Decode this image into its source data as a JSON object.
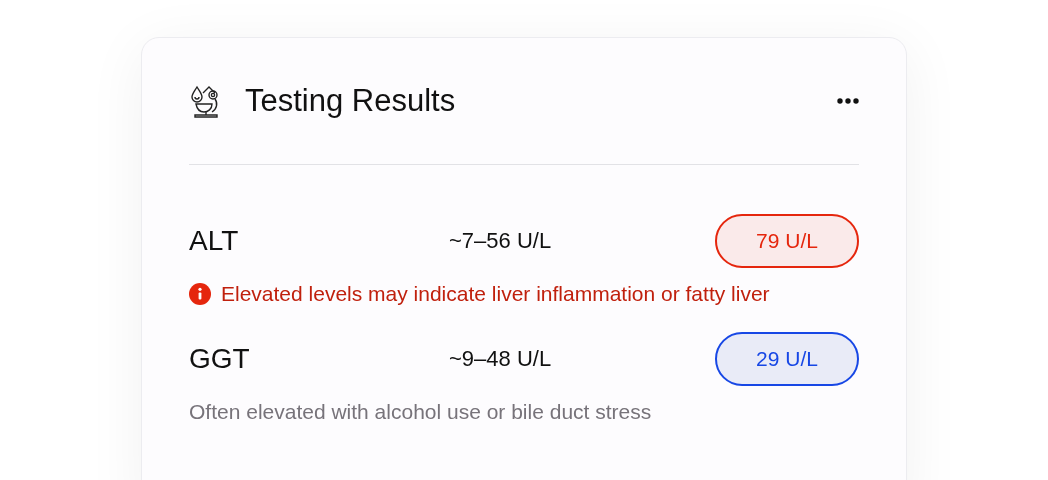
{
  "card": {
    "title": "Testing Results"
  },
  "results": [
    {
      "name": "ALT",
      "range": "~7–56 U/L",
      "value": "79 U/L",
      "kind": "high",
      "note": "Elevated levels may indicate liver inflammation or fatty liver"
    },
    {
      "name": "GGT",
      "range": "~9–48 U/L",
      "value": "29 U/L",
      "kind": "normal",
      "note": "Often elevated with alcohol use or bile duct stress"
    }
  ]
}
